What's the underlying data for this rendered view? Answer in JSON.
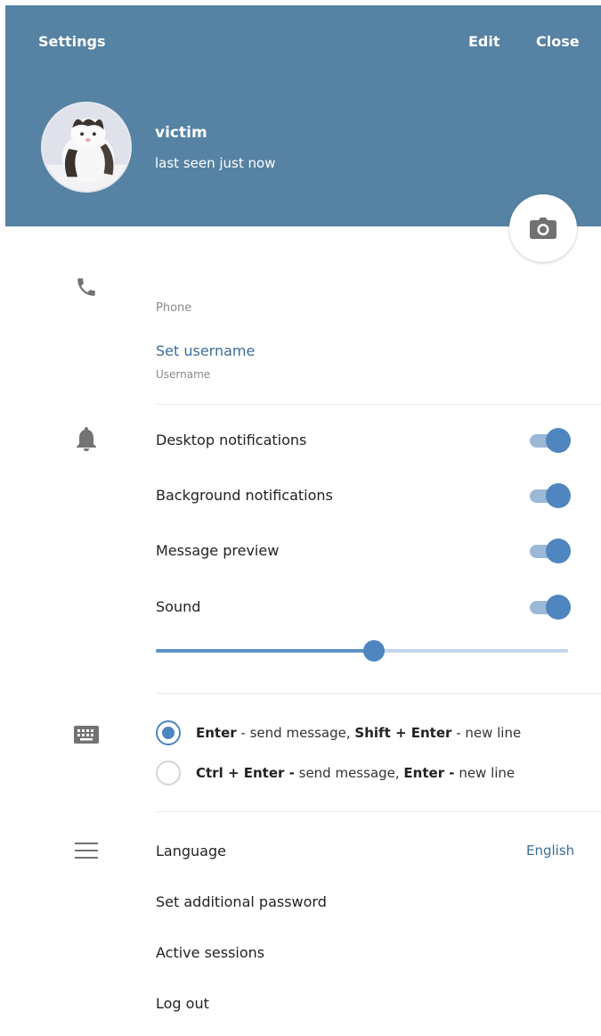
{
  "header": {
    "title": "Settings",
    "edit_label": "Edit",
    "close_label": "Close",
    "bg_color": "#5682a3"
  },
  "profile": {
    "name": "victim",
    "status": "last seen just now"
  },
  "account": {
    "phone_label": "Phone",
    "username_link": "Set username",
    "username_label": "Username"
  },
  "notifications": {
    "items": [
      {
        "label": "Desktop notifications",
        "enabled": true
      },
      {
        "label": "Background notifications",
        "enabled": true
      },
      {
        "label": "Message preview",
        "enabled": true
      },
      {
        "label": "Sound",
        "enabled": true
      }
    ],
    "volume_percent": 53
  },
  "send_mode": {
    "options": [
      {
        "key1": "Enter",
        "text1": " - send message, ",
        "key2": "Shift + Enter",
        "text2": " - new line",
        "selected": true
      },
      {
        "key1": "Ctrl + Enter -",
        "text1": " send message, ",
        "key2": "Enter -",
        "text2": " new line",
        "selected": false
      }
    ]
  },
  "general": {
    "language_label": "Language",
    "language_value": "English",
    "password_label": "Set additional password",
    "sessions_label": "Active sessions",
    "logout_label": "Log out"
  },
  "accent_color": "#4f86bf",
  "icons": {
    "camera": "camera-icon",
    "phone": "phone-icon",
    "bell": "bell-icon",
    "keyboard": "keyboard-icon",
    "menu": "menu-icon"
  }
}
